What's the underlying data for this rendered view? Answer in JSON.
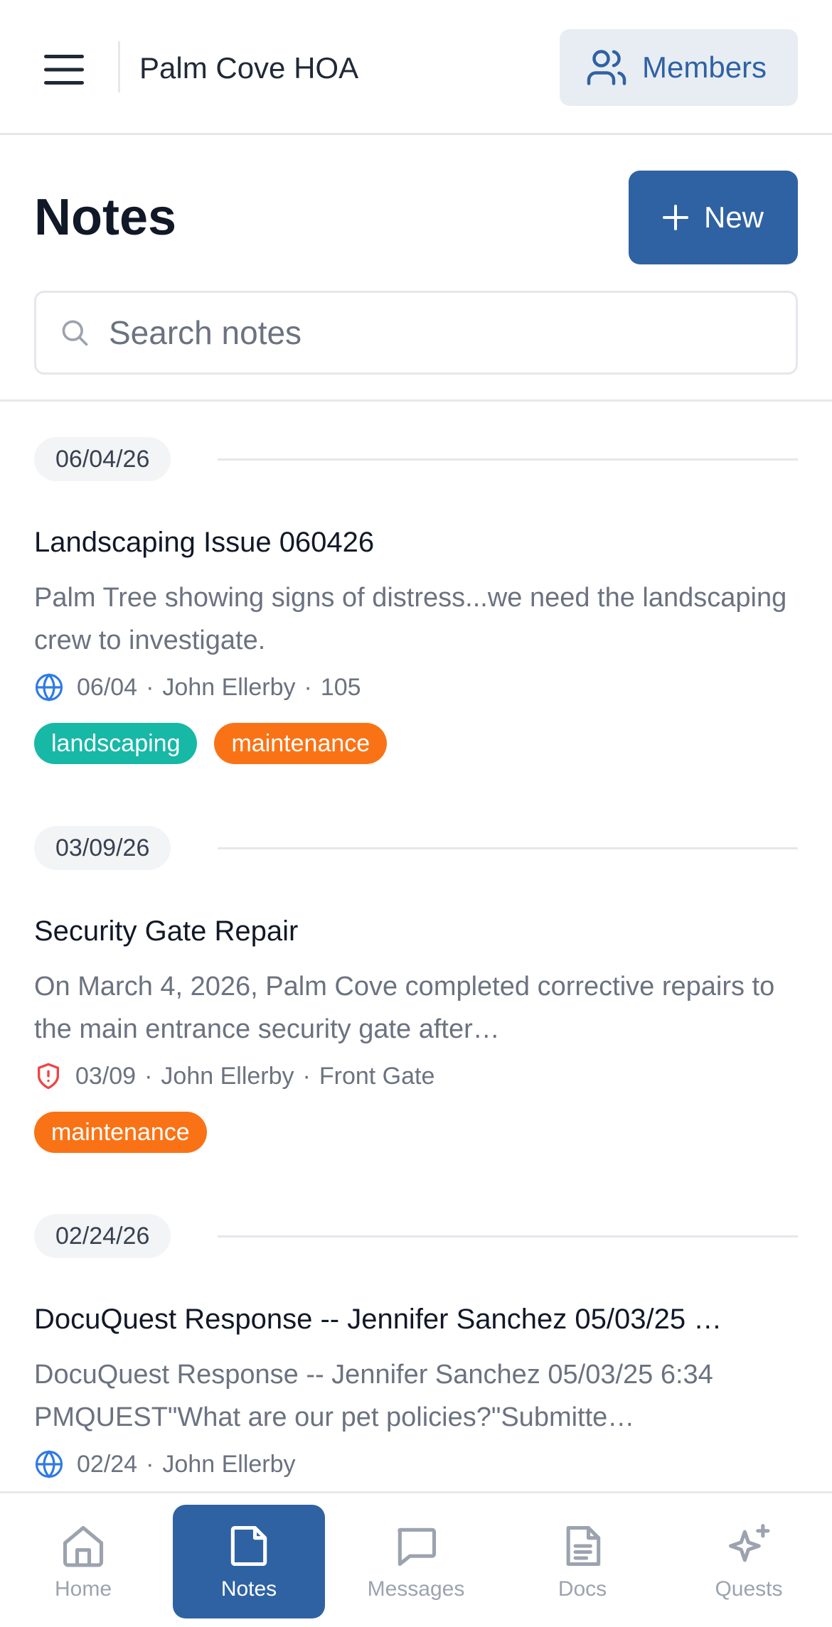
{
  "header": {
    "title": "Palm Cove HOA",
    "members_label": "Members"
  },
  "page": {
    "title": "Notes",
    "new_label": "New"
  },
  "search": {
    "placeholder": "Search notes"
  },
  "groups": [
    {
      "date": "06/04/26",
      "notes": [
        {
          "title": "Landscaping Issue 060426",
          "excerpt": "Palm Tree showing signs of distress...we need the landscaping crew to investigate.",
          "meta_icon": "globe-icon",
          "meta_date": "06/04",
          "author": "John Ellerby",
          "location": "105",
          "tags": [
            {
              "label": "landscaping",
              "color": "#17b8a6"
            },
            {
              "label": "maintenance",
              "color": "#f97316"
            }
          ]
        }
      ]
    },
    {
      "date": "03/09/26",
      "notes": [
        {
          "title": "Security Gate Repair",
          "excerpt": "On March 4, 2026, Palm Cove completed corrective repairs to the main entrance security gate after…",
          "meta_icon": "shield-alert-icon",
          "meta_date": "03/09",
          "author": "John Ellerby",
          "location": "Front Gate",
          "tags": [
            {
              "label": "maintenance",
              "color": "#f97316"
            }
          ]
        }
      ]
    },
    {
      "date": "02/24/26",
      "notes": [
        {
          "title": "DocuQuest Response -- Jennifer Sanchez 05/03/25 …",
          "excerpt": "DocuQuest Response -- Jennifer Sanchez 05/03/25 6:34 PMQUEST\"What are our pet policies?\"Submitte…",
          "meta_icon": "globe-icon",
          "meta_date": "02/24",
          "author": "John Ellerby"
        }
      ]
    }
  ],
  "bottom_nav": [
    {
      "label": "Home",
      "icon": "home-icon",
      "active": false
    },
    {
      "label": "Notes",
      "icon": "note-icon",
      "active": true
    },
    {
      "label": "Messages",
      "icon": "message-icon",
      "active": false
    },
    {
      "label": "Docs",
      "icon": "document-icon",
      "active": false
    },
    {
      "label": "Quests",
      "icon": "sparkle-icon",
      "active": false
    }
  ],
  "colors": {
    "primary": "#2f62a3",
    "members_bg": "#e8edf3",
    "landscaping_tag": "#17b8a6",
    "maintenance_tag": "#f97316",
    "globe_icon": "#2f7ae5",
    "shield_icon": "#ef4444"
  }
}
